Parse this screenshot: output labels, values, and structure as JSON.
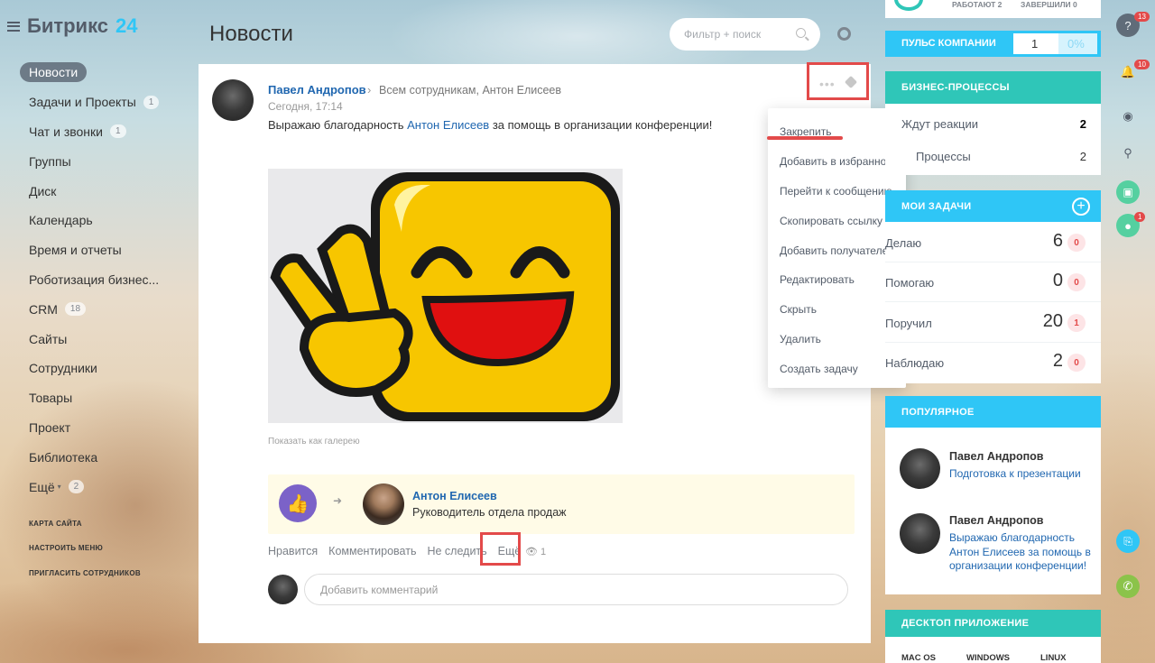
{
  "app": {
    "name": "Битрикс",
    "num": "24"
  },
  "page_title": "Новости",
  "search": {
    "placeholder": "Фильтр + поиск"
  },
  "nav": {
    "items": [
      {
        "label": "Новости",
        "badge": null
      },
      {
        "label": "Задачи и Проекты",
        "badge": "1"
      },
      {
        "label": "Чат и звонки",
        "badge": "1"
      },
      {
        "label": "Группы",
        "badge": null
      },
      {
        "label": "Диск",
        "badge": null
      },
      {
        "label": "Календарь",
        "badge": null
      },
      {
        "label": "Время и отчеты",
        "badge": null
      },
      {
        "label": "Роботизация бизнес...",
        "badge": null
      },
      {
        "label": "CRM",
        "badge": "18"
      },
      {
        "label": "Сайты",
        "badge": null
      },
      {
        "label": "Сотрудники",
        "badge": null
      },
      {
        "label": "Товары",
        "badge": null
      },
      {
        "label": "Проект",
        "badge": null
      },
      {
        "label": "Библиотека",
        "badge": null
      },
      {
        "label": "Ещё",
        "badge": "2"
      }
    ],
    "sitemap": "КАРТА САЙТА",
    "configure": "НАСТРОИТЬ МЕНЮ",
    "invite": "ПРИГЛАСИТЬ СОТРУДНИКОВ"
  },
  "post": {
    "author": "Павел Андропов",
    "destination": "Всем сотрудникам, Антон Елисеев",
    "date": "Сегодня, 17:14",
    "text_before": "Выражаю благодарность ",
    "mention": "Антон Елисеев",
    "text_after": "  за помощь в организации конференции!",
    "gallery": "Показать как галерею",
    "grat_name": "Антон Елисеев",
    "grat_position": "Руководитель отдела продаж",
    "actions": {
      "like": "Нравится",
      "comment": "Комментировать",
      "unfollow": "Не следить",
      "more": "Ещё"
    },
    "views": "1",
    "comment_placeholder": "Добавить комментарий"
  },
  "menu": {
    "items": [
      "Закрепить",
      "Добавить в избранное",
      "Перейти к сообщению",
      "Скопировать ссылку",
      "Добавить получателей",
      "Редактировать",
      "Скрыть",
      "Удалить",
      "Создать задачу"
    ]
  },
  "right": {
    "top_stats": {
      "working": "РАБОТАЮТ 2",
      "done": "ЗАВЕРШИЛИ 0"
    },
    "pulse": {
      "title": "ПУЛЬС КОМПАНИИ",
      "value": "1",
      "percent": "0%"
    },
    "bp": {
      "title": "БИЗНЕС-ПРОЦЕССЫ",
      "rows": [
        {
          "label": "Ждут реакции",
          "value": "2"
        },
        {
          "label": "Процессы",
          "value": "2"
        }
      ]
    },
    "tasks": {
      "title": "МОИ ЗАДАЧИ",
      "rows": [
        {
          "label": "Делаю",
          "value": "6",
          "badge": "0"
        },
        {
          "label": "Помогаю",
          "value": "0",
          "badge": "0"
        },
        {
          "label": "Поручил",
          "value": "20",
          "badge": "1"
        },
        {
          "label": "Наблюдаю",
          "value": "2",
          "badge": "0"
        }
      ]
    },
    "popular": {
      "title": "ПОПУЛЯРНОЕ",
      "items": [
        {
          "name": "Павел Андропов",
          "text": "Подготовка к презентации"
        },
        {
          "name": "Павел Андропов",
          "text": "Выражаю благодарность Антон Елисеев за помощь в организации конференции!"
        }
      ]
    },
    "desktop": {
      "title": "ДЕСКТОП ПРИЛОЖЕНИЕ",
      "mac": "MAC OS",
      "win": "WINDOWS",
      "linux": "LINUX"
    }
  },
  "rail": {
    "help_badge": "13",
    "bell_badge": "10",
    "user_badge": "1"
  },
  "colors": {
    "accent": "#2fc6f6",
    "link": "#2067b0",
    "highlight": "#e34a4a",
    "grat_icon": "#7b62c8"
  }
}
